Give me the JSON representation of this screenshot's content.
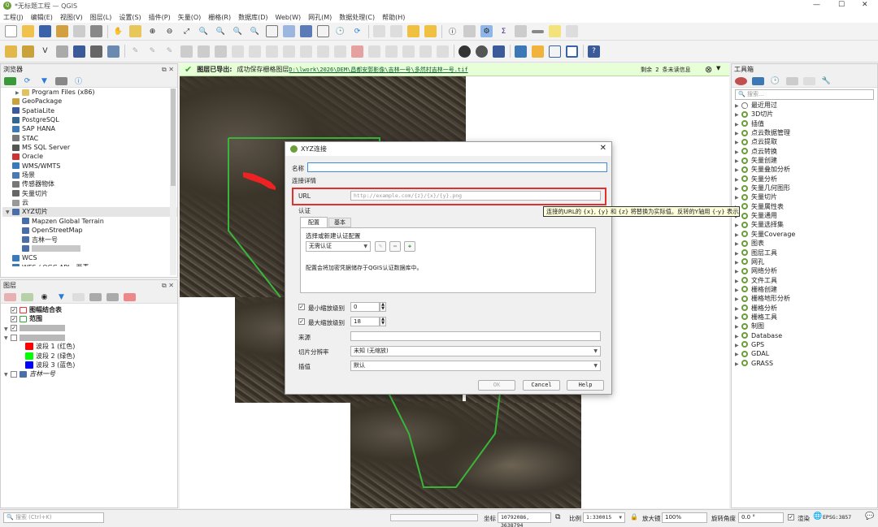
{
  "window": {
    "title": "*无标题工程 — QGIS"
  },
  "menu": [
    "工程(J)",
    "编辑(E)",
    "视图(V)",
    "图层(L)",
    "设置(S)",
    "插件(P)",
    "矢量(O)",
    "栅格(R)",
    "数据库(D)",
    "Web(W)",
    "网孔(M)",
    "数据处理(C)",
    "帮助(H)"
  ],
  "browser": {
    "title": "浏览器",
    "items": [
      {
        "label": "Program Files (x86)",
        "indent": 1,
        "icon": "folder-icon"
      },
      {
        "label": "GeoPackage",
        "indent": 0,
        "icon": "geopackage-icon"
      },
      {
        "label": "SpatiaLite",
        "indent": 0,
        "icon": "spatialite-icon"
      },
      {
        "label": "PostgreSQL",
        "indent": 0,
        "icon": "postgresql-icon"
      },
      {
        "label": "SAP HANA",
        "indent": 0,
        "icon": "hana-icon"
      },
      {
        "label": "STAC",
        "indent": 0,
        "icon": "stac-icon"
      },
      {
        "label": "MS SQL Server",
        "indent": 0,
        "icon": "mssql-icon"
      },
      {
        "label": "Oracle",
        "indent": 0,
        "icon": "oracle-icon"
      },
      {
        "label": "WMS/WMTS",
        "indent": 0,
        "icon": "wms-icon"
      },
      {
        "label": "场景",
        "indent": 0,
        "icon": "scene-icon"
      },
      {
        "label": "传感器物体",
        "indent": 0,
        "icon": "sensor-icon"
      },
      {
        "label": "矢量切片",
        "indent": 0,
        "icon": "vector-tile-icon"
      },
      {
        "label": "云",
        "indent": 0,
        "icon": "cloud-icon"
      },
      {
        "label": "XYZ切片",
        "indent": 0,
        "icon": "xyz-icon",
        "expanded": true,
        "selected": true
      },
      {
        "label": "Mapzen Global Terrain",
        "indent": 1,
        "icon": "xyz-icon"
      },
      {
        "label": "OpenStreetMap",
        "indent": 1,
        "icon": "xyz-icon"
      },
      {
        "label": "吉林一号",
        "indent": 1,
        "icon": "xyz-icon"
      },
      {
        "label": "",
        "indent": 1,
        "icon": "xyz-icon",
        "blurred": true
      },
      {
        "label": "WCS",
        "indent": 0,
        "icon": "wcs-icon"
      },
      {
        "label": "WFS / OGC API - 要素",
        "indent": 0,
        "icon": "wfs-icon"
      }
    ]
  },
  "layers": {
    "title": "图层",
    "items": [
      {
        "label": "图幅结合表",
        "checked": true,
        "swatch": "#e33",
        "bold": true
      },
      {
        "label": "范围",
        "checked": true,
        "swatch": "#3a3",
        "bold": true
      },
      {
        "label": "",
        "checked": true,
        "blurred": true
      },
      {
        "label": "",
        "checked": false,
        "blurred": true
      },
      {
        "label": "波段 1 (红色)",
        "band": "#ff0000"
      },
      {
        "label": "波段 2 (绿色)",
        "band": "#00ff00"
      },
      {
        "label": "波段 3 (蓝色)",
        "band": "#0000ff"
      },
      {
        "label": "吉林一号",
        "checked": false,
        "italic": true
      }
    ]
  },
  "notification": {
    "title": "图层已导出:",
    "message": "成功保存栅格图层",
    "path": "D:\\lwork\\2026\\DEM\\昌都安郭影像\\吉林一号\\多然村吉林一号.tif",
    "remaining": "剩余 2 条未读信息"
  },
  "dialog": {
    "title": "XYZ连接",
    "name_label": "名称",
    "name_value": "",
    "details_label": "连接详情",
    "url_label": "URL",
    "url_placeholder": "http://example.com/{z}/{x}/{y}.png",
    "auth_label": "认证",
    "tabs": [
      "配置",
      "基本"
    ],
    "select_config_label": "选择或新建认证配置",
    "auth_value": "无需认证",
    "auth_note": "配置会将加密凭据储存于QGIS认证数据库中。",
    "min_zoom_label": "最小缩放级别",
    "min_zoom": "0",
    "max_zoom_label": "最大缩放级别",
    "max_zoom": "18",
    "referer_label": "来源",
    "tile_res_label": "切片分辨率",
    "tile_res_value": "未知 (无缩放)",
    "interp_label": "插值",
    "interp_value": "默认",
    "ok": "OK",
    "cancel": "Cancel",
    "help": "Help"
  },
  "tooltip": "连接的URL的 {x}, {y} 和 {z} 将替换为实际值。反转的Y轴用 {-y} 表示。",
  "toolbox": {
    "title": "工具箱",
    "search_placeholder": "搜索...",
    "items": [
      "最近用过",
      "3D切片",
      "插值",
      "点云数据管理",
      "点云提取",
      "点云转换",
      "矢量创建",
      "矢量叠加分析",
      "矢量分析",
      "矢量几何图形",
      "矢量切片",
      "矢量属性表",
      "矢量通用",
      "矢量选择集",
      "矢量Coverage",
      "图表",
      "图层工具",
      "网孔",
      "网络分析",
      "文件工具",
      "栅格创建",
      "栅格地形分析",
      "栅格分析",
      "栅格工具",
      "制图",
      "Database",
      "GPS",
      "GDAL",
      "GRASS"
    ]
  },
  "status": {
    "search_placeholder": "搜索 (Ctrl+K)",
    "coord_label": "坐标",
    "coord_value": "10792086, 3638794",
    "scale_label": "比例",
    "scale_value": "1:330015",
    "magnifier_label": "放大镜",
    "magnifier_value": "100%",
    "rotation_label": "旋转角度",
    "rotation_value": "0.0 °",
    "render_label": "渲染",
    "crs": "EPSG:3857"
  },
  "colors": {
    "accent": "#6b9e3a",
    "url_highlight": "#e03030",
    "boundary": "#39b539",
    "tile_frame": "#ee2222"
  }
}
